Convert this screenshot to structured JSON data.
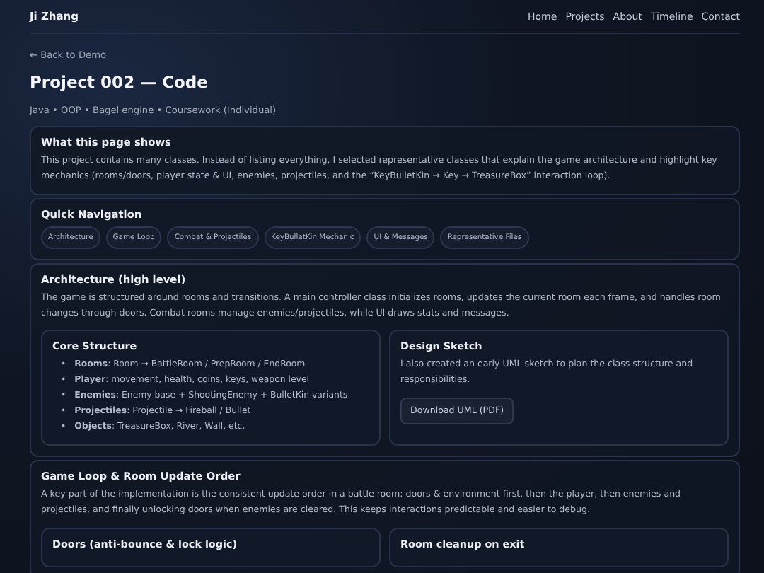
{
  "header": {
    "brand": "Ji Zhang",
    "nav": [
      "Home",
      "Projects",
      "About",
      "Timeline",
      "Contact"
    ]
  },
  "back_link": "← Back to Demo",
  "title": "Project 002 — Code",
  "subtitle": "Java • OOP • Bagel engine • Coursework (Individual)",
  "sections": [
    {
      "kind": "text",
      "heading": "What this page shows",
      "body": "This project contains many classes. Instead of listing everything, I selected representative classes that explain the game architecture and highlight key mechanics (rooms/doors, player state & UI, enemies, projectiles, and the “KeyBulletKin → Key → TreasureBox” interaction loop)."
    },
    {
      "kind": "chips",
      "heading": "Quick Navigation",
      "chips": [
        "Architecture",
        "Game Loop",
        "Combat & Projectiles",
        "KeyBulletKin Mechanic",
        "UI & Messages",
        "Representative Files"
      ]
    },
    {
      "kind": "text",
      "heading": "Architecture (high level)",
      "body": "The game is structured around rooms and transitions. A main controller class initializes rooms, updates the current room each frame, and handles room changes through doors. Combat rooms manage enemies/projectiles, while UI draws stats and messages.",
      "cards": [
        {
          "kind": "list",
          "heading": "Core Structure",
          "marker": "•",
          "items": [
            "**Rooms**: Room → BattleRoom / PrepRoom / EndRoom",
            "**Player**: movement, health, coins, keys, weapon level",
            "**Enemies**: Enemy base + ShootingEnemy + BulletKin variants",
            "**Projectiles**: Projectile → Fireball / Bullet",
            "**Objects**: TreasureBox, River, Wall, etc."
          ]
        },
        {
          "kind": "download",
          "heading": "Design Sketch",
          "body": "I also created an early UML sketch to plan the class structure and responsibilities.",
          "button": "Download UML (PDF)"
        }
      ]
    },
    {
      "kind": "text",
      "heading": "Game Loop & Room Update Order",
      "body": "A key part of the implementation is the consistent update order in a battle room: doors & environment first, then the player, then enemies and projectiles, and finally unlocking doors when enemies are cleared. This keeps interactions predictable and easier to debug.",
      "cards": [
        {
          "kind": "heading_only",
          "heading": "Doors (anti-bounce & lock logic)"
        },
        {
          "kind": "heading_only",
          "heading": "Room cleanup on exit"
        }
      ]
    }
  ]
}
